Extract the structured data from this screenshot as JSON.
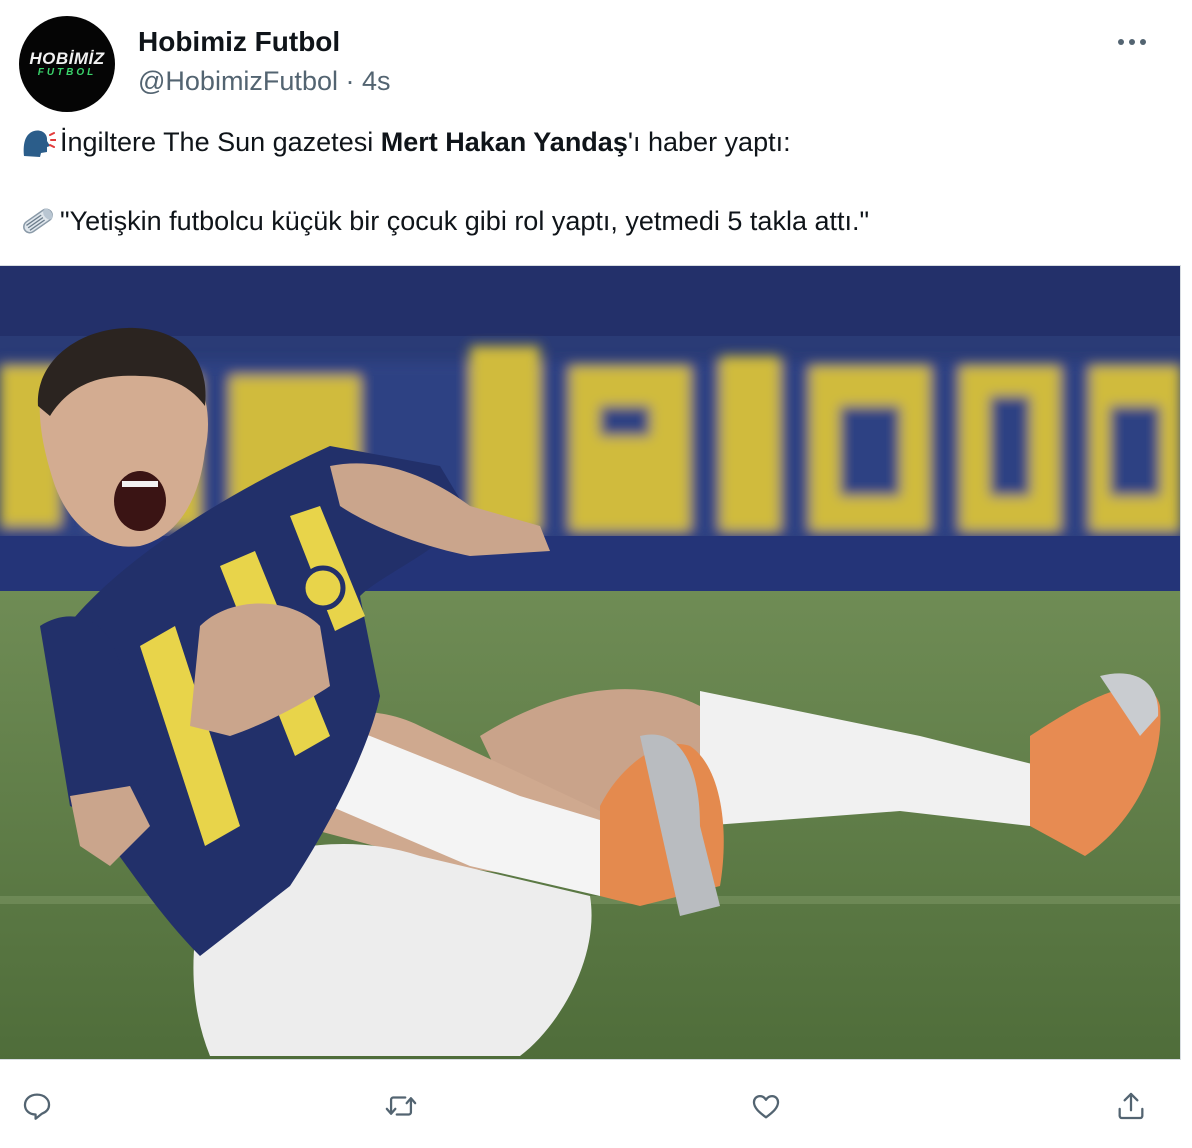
{
  "account": {
    "display_name": "Hobimiz Futbol",
    "handle": "@HobimizFutbol",
    "separator": "·",
    "time": "4s",
    "avatar_logo_top": "HOBİMİZ",
    "avatar_logo_bottom": "FUTBOL"
  },
  "tweet": {
    "line1_prefix": "İngiltere The Sun gazetesi ",
    "line1_bold": "Mert Hakan Yandaş",
    "line1_suffix": "'ı haber yaptı:",
    "line2_text": "\"Yetişkin futbolcu küçük bir çocuk gibi rol yaptı, yetmedi 5 takla attı.\"",
    "line1_icon": "speaking-head-icon",
    "line2_icon": "rolled-newspaper-icon"
  },
  "media": {
    "kind": "photo",
    "banner_text": "İZİNDEYİZ",
    "colors": {
      "pitch": "#5f7d47",
      "board": "#283a78",
      "banner": "#d9c23a",
      "jersey_navy": "#22306a",
      "jersey_yellow": "#e8d44a",
      "sock": "#f2f2f2",
      "boot": "#e98a4f"
    }
  },
  "actions": [
    {
      "name": "reply-button",
      "icon": "speech-bubble-icon"
    },
    {
      "name": "retweet-button",
      "icon": "retweet-arrows-icon"
    },
    {
      "name": "like-button",
      "icon": "heart-icon"
    },
    {
      "name": "share-button",
      "icon": "share-upload-icon"
    }
  ],
  "colors": {
    "text": "#0f1419",
    "secondary": "#536471",
    "border": "#d8dde1"
  }
}
